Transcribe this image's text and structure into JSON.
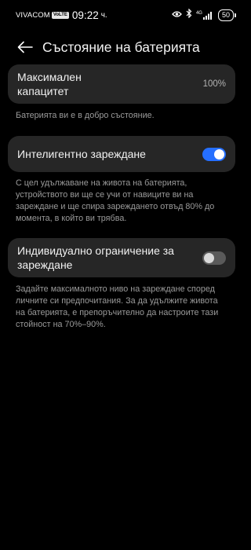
{
  "status_bar": {
    "carrier": "VIVACOM",
    "volte": "VoLTE",
    "time": "09:22",
    "time_suffix": "ч.",
    "network": "4G",
    "battery": "50"
  },
  "header": {
    "title": "Състояние на батерията"
  },
  "capacity": {
    "label": "Максимален капацитет",
    "value": "100%",
    "description": "Батерията ви е в добро състояние."
  },
  "smart_charging": {
    "label": "Интелигентно зареждане",
    "enabled": true,
    "description": "С цел удължаване на живота на батерията, устройството ви ще се учи от навиците ви на зареждане и ще спира зареждането отвъд 80% до момента, в който ви трябва."
  },
  "custom_limit": {
    "label": "Индивидуално ограничение за зареждане",
    "enabled": false,
    "description": "Задайте максималното ниво на зареждане според личните си предпочитания. За да удължите живота на батерията, е препоръчително да настроите тази стойност на 70%–90%."
  },
  "colors": {
    "background": "#000000",
    "card": "#262626",
    "accent": "#256fff",
    "secondary_text": "#9a9a9a"
  }
}
